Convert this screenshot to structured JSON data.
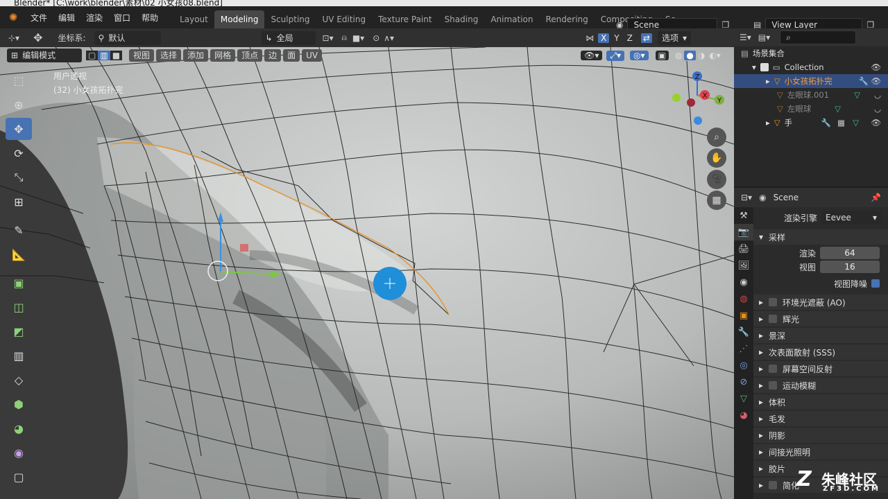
{
  "titlebar": {
    "text": "Blender* [C:\\work\\blender\\素材\\02 小女孩08.blend]"
  },
  "menu": [
    "文件",
    "编辑",
    "渲染",
    "窗口",
    "帮助"
  ],
  "workspace_tabs": [
    "Layout",
    "Modeling",
    "Sculpting",
    "UV Editing",
    "Texture Paint",
    "Shading",
    "Animation",
    "Rendering",
    "Compositing",
    "Sc"
  ],
  "active_tab": "Modeling",
  "scene": "Scene",
  "view_layer": "View Layer",
  "tool_header": {
    "coord_label": "坐标系:",
    "coord_value": "默认",
    "orientation": "全局",
    "options": "选项",
    "axes": [
      "X",
      "Y",
      "Z"
    ]
  },
  "mode_header": {
    "mode": "编辑模式",
    "buttons": [
      "视图",
      "选择",
      "添加",
      "网格",
      "顶点",
      "边",
      "面",
      "UV"
    ]
  },
  "viewport_info": {
    "line1": "用户透视",
    "line2": "(32) 小女孩拓扑完"
  },
  "gizmo": {
    "z": "Z",
    "x": "X",
    "y": "Y"
  },
  "outliner": {
    "root": "场景集合",
    "collection": "Collection",
    "items": [
      "小女孩拓扑完",
      "左眼球.001",
      "左眼球",
      "手"
    ]
  },
  "properties": {
    "scene": "Scene",
    "engine_label": "渲染引擎",
    "engine_value": "Eevee",
    "sampling": "采样",
    "render_label": "渲染",
    "render_value": "64",
    "viewport_label": "视图",
    "viewport_value": "16",
    "denoise": "视图降噪",
    "panels": [
      "环境光遮蔽 (AO)",
      "辉光",
      "景深",
      "次表面散射 (SSS)",
      "屏幕空间反射",
      "运动模糊",
      "体积",
      "毛发",
      "阴影",
      "间接光照明",
      "胶片",
      "简化"
    ]
  },
  "watermark": {
    "line1": "朱峰社区",
    "line2": "ZF3D.COM"
  },
  "colors": {
    "accent": "#4772b3",
    "selected_edge": "#e8901e",
    "bg": "#1d1d1d"
  }
}
